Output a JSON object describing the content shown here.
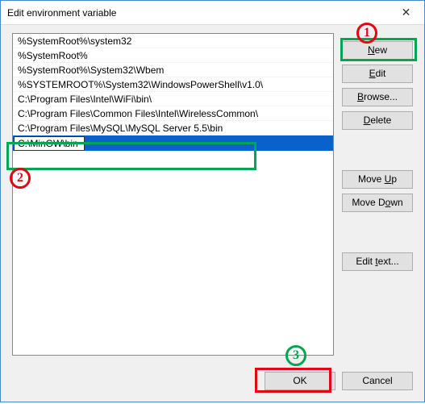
{
  "window": {
    "title": "Edit environment variable"
  },
  "list": {
    "items": [
      "%SystemRoot%\\system32",
      "%SystemRoot%",
      "%SystemRoot%\\System32\\Wbem",
      "%SYSTEMROOT%\\System32\\WindowsPowerShell\\v1.0\\",
      "C:\\Program Files\\Intel\\WiFi\\bin\\",
      "C:\\Program Files\\Common Files\\Intel\\WirelessCommon\\",
      "C:\\Program Files\\MySQL\\MySQL Server 5.5\\bin"
    ],
    "edit_value": "C:\\MinGW\\bin"
  },
  "buttons": {
    "new": "New",
    "edit": "Edit",
    "browse": "Browse...",
    "delete": "Delete",
    "move_up": "Move Up",
    "move_down": "Move Down",
    "edit_text": "Edit text...",
    "ok": "OK",
    "cancel": "Cancel"
  },
  "annotations": {
    "one": "1",
    "two": "2",
    "three": "3"
  }
}
